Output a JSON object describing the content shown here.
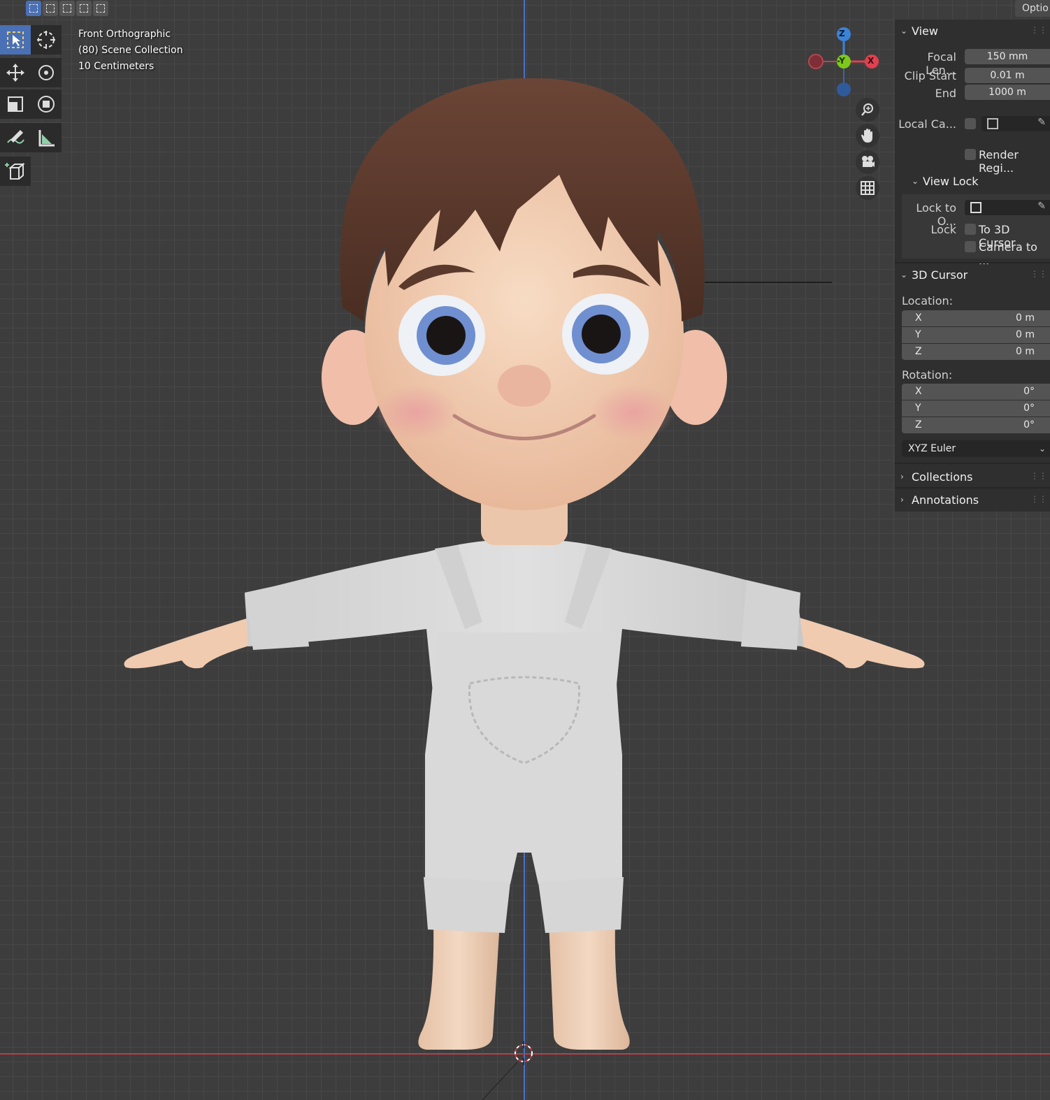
{
  "header": {
    "select_mode_icons": [
      "select-new-icon",
      "select-extend-icon",
      "select-subtract-icon",
      "select-invert-icon",
      "select-intersect-icon"
    ],
    "options_label": "Optio"
  },
  "toolbar": {
    "tools": [
      "select-box-icon",
      "cursor-icon",
      "move-icon",
      "rotate-icon",
      "scale-icon",
      "transform-icon",
      "annotate-icon",
      "measure-icon",
      "add-cube-icon"
    ],
    "active_tool": "select-box-icon"
  },
  "viewport_info": {
    "view_name": "Front Orthographic",
    "collection": "(80) Scene Collection",
    "grid_scale": "10 Centimeters"
  },
  "gizmo": {
    "z_label": "Z",
    "y_label": "-Y",
    "x_label": "X"
  },
  "nav_buttons": [
    "zoom-icon",
    "pan-hand-icon",
    "camera-icon",
    "grid-icon"
  ],
  "panel": {
    "view": {
      "title": "View",
      "focal_length_label": "Focal Len...",
      "focal_length_value": "150 mm",
      "clip_start_label": "Clip Start",
      "clip_start_value": "0.01 m",
      "clip_end_label": "End",
      "clip_end_value": "1000 m",
      "local_camera_label": "Local Ca...",
      "render_region_label": "Render Regi..."
    },
    "view_lock": {
      "title": "View Lock",
      "lock_to_object_label": "Lock to O...",
      "lock_label": "Lock",
      "to_3d_cursor_label": "To 3D Cursor",
      "camera_to_view_label": "Camera to ..."
    },
    "cursor": {
      "title": "3D Cursor",
      "location_label": "Location:",
      "location": [
        {
          "axis": "X",
          "value": "0 m"
        },
        {
          "axis": "Y",
          "value": "0 m"
        },
        {
          "axis": "Z",
          "value": "0 m"
        }
      ],
      "rotation_label": "Rotation:",
      "rotation": [
        {
          "axis": "X",
          "value": "0°"
        },
        {
          "axis": "Y",
          "value": "0°"
        },
        {
          "axis": "Z",
          "value": "0°"
        }
      ],
      "rotation_mode": "XYZ Euler"
    },
    "collections_title": "Collections",
    "annotations_title": "Annotations"
  },
  "colors": {
    "accent": "#4a70b5",
    "axis_x": "#e0404f",
    "axis_y": "#7cc91b",
    "axis_z": "#3b83d6",
    "hair": "#5a3a2c",
    "skin": "#f0cbb0",
    "clothes": "#d9d9d9",
    "eyes": "#6f8fd0"
  }
}
